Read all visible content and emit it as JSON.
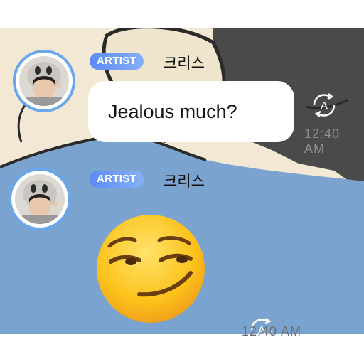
{
  "messages": [
    {
      "badge": "ARTIST",
      "sender": "크리스",
      "text": "Jealous much?",
      "time": "12:40 AM",
      "avatar_icon": "profile-photo",
      "auto_icon": "auto-translate-icon"
    },
    {
      "badge": "ARTIST",
      "sender": "크리스",
      "emoji": "😏",
      "emoji_name": "smirking-face-emoji",
      "time": "12:40 AM",
      "avatar_icon": "profile-photo",
      "auto_icon": "auto-translate-icon"
    }
  ],
  "colors": {
    "badge_start": "#5b8cf6",
    "badge_end": "#86aef9",
    "avatar_ring": "#6aa6ea",
    "chat_bg_cream": "#f2e8d3",
    "chat_bg_blue": "#7ba3cf",
    "chat_bg_dark": "#4a4a4a"
  }
}
